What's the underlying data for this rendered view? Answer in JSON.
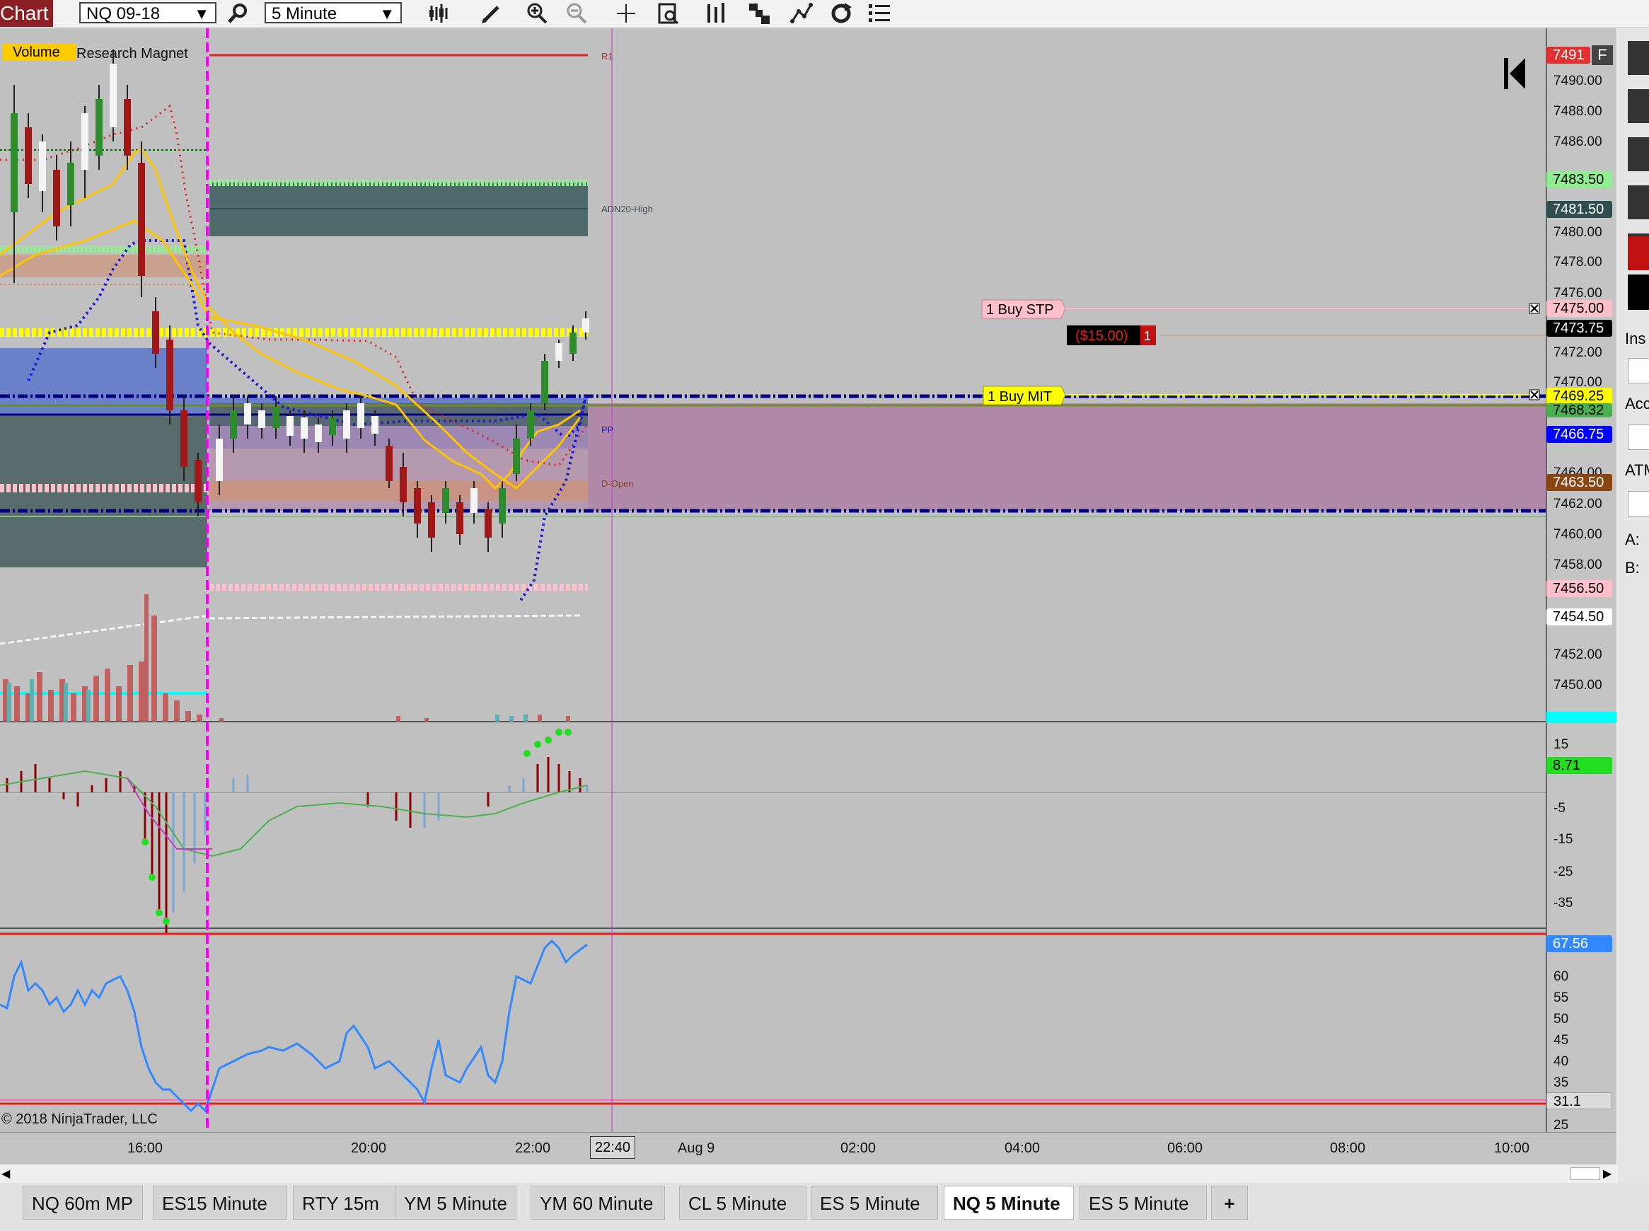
{
  "toolbar": {
    "title": "Chart",
    "instrument": "NQ 09-18",
    "interval": "5 Minute"
  },
  "chart": {
    "indicator_badge": "Volume",
    "indicator_name": "Research Magnet",
    "copyright": "© 2018 NinjaTrader, LLC",
    "level_labels": {
      "r1": "R1",
      "adn20": "ADN20-High",
      "pp": "PP",
      "dopen": "D-Open"
    },
    "orders": {
      "buy_stp": "1 Buy STP",
      "buy_mit": "1 Buy MIT",
      "pnl": "($15.00)",
      "qty": "1"
    },
    "price_ticks": [
      "7490.00",
      "7488.00",
      "7486.00",
      "7480.00",
      "7478.00",
      "7476.00",
      "7472.00",
      "7470.00",
      "7464.00",
      "7462.00",
      "7460.00",
      "7458.00",
      "7452.00",
      "7450.00"
    ],
    "price_tags": [
      {
        "text": "7491",
        "bg": "#e03030",
        "fg": "#ffffff"
      },
      {
        "text": "7483.50",
        "bg": "#90ee90",
        "fg": "#000000"
      },
      {
        "text": "7481.50",
        "bg": "#2f4f4f",
        "fg": "#ffffff"
      },
      {
        "text": "7475.00",
        "bg": "#ffc0cb",
        "fg": "#000000"
      },
      {
        "text": "7473.75",
        "bg": "#000000",
        "fg": "#ffffff"
      },
      {
        "text": "7469.25",
        "bg": "#ffff00",
        "fg": "#000000"
      },
      {
        "text": "7468.32",
        "bg": "#4caf50",
        "fg": "#000000"
      },
      {
        "text": "7466.75",
        "bg": "#0000ff",
        "fg": "#ffffff"
      },
      {
        "text": "7463.50",
        "bg": "#8b4513",
        "fg": "#ffffff"
      },
      {
        "text": "7456.50",
        "bg": "#ffc0cb",
        "fg": "#000000"
      },
      {
        "text": "7454.50",
        "bg": "#ffffff",
        "fg": "#000000"
      }
    ],
    "macd_ticks": [
      "15",
      "-5",
      "-15",
      "-25",
      "-35"
    ],
    "macd_tag": "8.71",
    "rsi_ticks": [
      "60",
      "55",
      "50",
      "45",
      "40",
      "35",
      "25"
    ],
    "rsi_tag_top": "67.56",
    "rsi_tag_bottom": "31.1",
    "time_labels": [
      "16:00",
      "20:00",
      "22:00",
      "Aug 9",
      "02:00",
      "04:00",
      "06:00",
      "08:00",
      "10:00"
    ],
    "cursor_time": "22:40"
  },
  "right_panel": {
    "labels": [
      "Ins",
      "Acc",
      "ATM",
      "A:",
      "B:"
    ]
  },
  "tabs": [
    {
      "label": "NQ 60m MP"
    },
    {
      "label": "ES15 Minute"
    },
    {
      "label": "RTY 15m"
    },
    {
      "label": "YM 5 Minute"
    },
    {
      "label": "YM 60 Minute"
    },
    {
      "label": "CL 5 Minute"
    },
    {
      "label": "ES 5 Minute"
    },
    {
      "label": "NQ 5 Minute",
      "active": true
    },
    {
      "label": "ES 5 Minute"
    },
    {
      "label": "+"
    }
  ]
}
